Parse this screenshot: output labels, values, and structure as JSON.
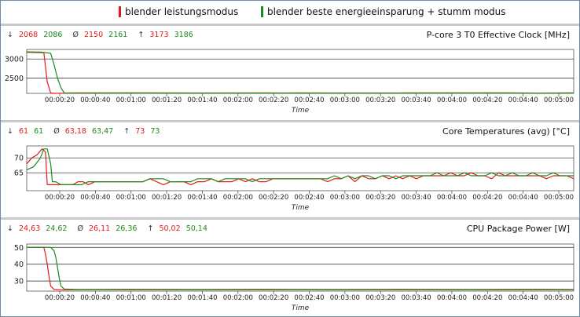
{
  "legend": [
    {
      "label": "blender leistungsmodus",
      "color": "#e31a1c"
    },
    {
      "label": "blender beste energieeinsparung + stumm modus",
      "color": "#1d8a1d"
    }
  ],
  "panels": [
    {
      "stats": {
        "min_symbol": "↓",
        "min_a": "2068",
        "min_b": "2086",
        "avg_symbol": "Ø",
        "avg_a": "2150",
        "avg_b": "2161",
        "max_symbol": "↑",
        "max_a": "3173",
        "max_b": "3186"
      }
    },
    {
      "stats": {
        "min_symbol": "↓",
        "min_a": "61",
        "min_b": "61",
        "avg_symbol": "Ø",
        "avg_a": "63,18",
        "avg_b": "63,47",
        "max_symbol": "↑",
        "max_a": "73",
        "max_b": "73"
      }
    },
    {
      "stats": {
        "min_symbol": "↓",
        "min_a": "24,63",
        "min_b": "24,62",
        "avg_symbol": "Ø",
        "avg_a": "26,11",
        "avg_b": "26,36",
        "max_symbol": "↑",
        "max_a": "50,02",
        "max_b": "50,14"
      }
    }
  ],
  "chart_data": [
    {
      "type": "line",
      "title": "P-core 3 T0 Effective Clock [MHz]",
      "xlabel": "Time",
      "ylabel": "",
      "ylim": [
        2100,
        3250
      ],
      "yticks": [
        2500,
        3000
      ],
      "xlim": [
        0,
        320
      ],
      "xticks": [
        "00:00:20",
        "00:00:40",
        "00:01:00",
        "00:01:20",
        "00:01:40",
        "00:02:00",
        "00:02:20",
        "00:02:40",
        "00:03:00",
        "00:03:20",
        "00:03:40",
        "00:04:00",
        "00:04:20",
        "00:04:40",
        "00:05:00"
      ],
      "grid": true,
      "series": [
        {
          "name": "blender leistungsmodus",
          "color": "#e31a1c",
          "x": [
            0,
            5,
            10,
            12,
            14,
            16,
            18,
            30,
            60,
            100,
            140,
            160,
            180,
            200,
            220,
            250,
            280,
            300,
            320
          ],
          "y": [
            3173,
            3170,
            3165,
            2400,
            2110,
            2100,
            2105,
            2105,
            2110,
            2108,
            2112,
            2105,
            2108,
            2110,
            2108,
            2112,
            2110,
            2106,
            2110
          ]
        },
        {
          "name": "blender beste energieeinsparung + stumm modus",
          "color": "#1d8a1d",
          "x": [
            0,
            8,
            14,
            16,
            18,
            20,
            22,
            30,
            60,
            100,
            140,
            160,
            180,
            200,
            220,
            250,
            280,
            300,
            320
          ],
          "y": [
            3186,
            3180,
            3150,
            2850,
            2500,
            2250,
            2110,
            2115,
            2112,
            2110,
            2108,
            2112,
            2110,
            2108,
            2112,
            2110,
            2115,
            2108,
            2112
          ]
        }
      ]
    },
    {
      "type": "line",
      "title": "Core Temperatures (avg) [°C]",
      "xlabel": "Time",
      "ylabel": "",
      "ylim": [
        59,
        74
      ],
      "yticks": [
        65,
        70
      ],
      "xlim": [
        0,
        320
      ],
      "xticks": [
        "00:00:20",
        "00:00:40",
        "00:01:00",
        "00:01:20",
        "00:01:40",
        "00:02:00",
        "00:02:20",
        "00:02:40",
        "00:03:00",
        "00:03:20",
        "00:03:40",
        "00:04:00",
        "00:04:20",
        "00:04:40",
        "00:05:00"
      ],
      "grid": true,
      "series": [
        {
          "name": "blender leistungsmodus",
          "color": "#e31a1c",
          "x": [
            0,
            3,
            6,
            9,
            11,
            12,
            13,
            15,
            18,
            20,
            22,
            24,
            27,
            30,
            33,
            36,
            40,
            44,
            48,
            52,
            56,
            60,
            64,
            68,
            72,
            76,
            80,
            84,
            88,
            92,
            96,
            100,
            104,
            108,
            112,
            116,
            120,
            124,
            128,
            132,
            136,
            140,
            144,
            148,
            152,
            156,
            160,
            164,
            168,
            172,
            176,
            180,
            184,
            188,
            192,
            196,
            200,
            204,
            208,
            212,
            216,
            220,
            224,
            228,
            232,
            236,
            240,
            244,
            248,
            252,
            256,
            260,
            264,
            268,
            272,
            276,
            280,
            284,
            288,
            292,
            296,
            300,
            304,
            308,
            312,
            316,
            320
          ],
          "y": [
            68,
            70,
            71,
            73,
            72,
            61,
            61,
            61,
            61,
            61,
            61,
            61,
            61,
            62,
            62,
            61,
            62,
            62,
            62,
            62,
            62,
            62,
            62,
            62,
            63,
            62,
            61,
            62,
            62,
            62,
            61,
            62,
            62,
            63,
            62,
            62,
            62,
            63,
            62,
            63,
            62,
            62,
            63,
            63,
            63,
            63,
            63,
            63,
            63,
            63,
            62,
            63,
            63,
            64,
            62,
            64,
            63,
            63,
            64,
            63,
            64,
            63,
            64,
            63,
            64,
            64,
            64,
            64,
            65,
            64,
            64,
            65,
            64,
            64,
            63,
            65,
            64,
            64,
            64,
            64,
            64,
            64,
            63,
            64,
            64,
            64,
            63
          ]
        },
        {
          "name": "blender beste energieeinsparung + stumm modus",
          "color": "#1d8a1d",
          "x": [
            0,
            4,
            8,
            10,
            12,
            14,
            15,
            17,
            20,
            24,
            28,
            32,
            36,
            40,
            44,
            48,
            52,
            56,
            60,
            64,
            68,
            72,
            76,
            80,
            84,
            88,
            92,
            96,
            100,
            104,
            108,
            112,
            116,
            120,
            124,
            128,
            132,
            136,
            140,
            144,
            148,
            152,
            156,
            160,
            164,
            168,
            172,
            176,
            180,
            184,
            188,
            192,
            196,
            200,
            204,
            208,
            212,
            216,
            220,
            224,
            228,
            232,
            236,
            240,
            244,
            248,
            252,
            256,
            260,
            264,
            268,
            272,
            276,
            280,
            284,
            288,
            292,
            296,
            300,
            304,
            308,
            312,
            316,
            320
          ],
          "y": [
            66,
            67,
            70,
            73,
            73,
            68,
            62,
            62,
            61,
            61,
            61,
            61,
            62,
            62,
            62,
            62,
            62,
            62,
            62,
            62,
            62,
            63,
            63,
            63,
            62,
            62,
            62,
            62,
            63,
            63,
            63,
            62,
            63,
            63,
            63,
            63,
            62,
            63,
            63,
            63,
            63,
            63,
            63,
            63,
            63,
            63,
            63,
            63,
            64,
            63,
            64,
            63,
            64,
            64,
            63,
            64,
            64,
            63,
            64,
            64,
            64,
            64,
            64,
            65,
            64,
            64,
            64,
            65,
            64,
            64,
            64,
            65,
            64,
            64,
            65,
            64,
            64,
            65,
            64,
            64,
            65,
            64,
            64,
            64
          ]
        }
      ]
    },
    {
      "type": "line",
      "title": "CPU Package Power [W]",
      "xlabel": "Time",
      "ylabel": "",
      "ylim": [
        24,
        52
      ],
      "yticks": [
        30,
        40,
        50
      ],
      "xlim": [
        0,
        320
      ],
      "xticks": [
        "00:00:20",
        "00:00:40",
        "00:01:00",
        "00:01:20",
        "00:01:40",
        "00:02:00",
        "00:02:20",
        "00:02:40",
        "00:03:00",
        "00:03:20",
        "00:03:40",
        "00:04:00",
        "00:04:20",
        "00:04:40",
        "00:05:00"
      ],
      "grid": true,
      "series": [
        {
          "name": "blender leistungsmodus",
          "color": "#e31a1c",
          "x": [
            0,
            5,
            10,
            11,
            12,
            13,
            14,
            16,
            20,
            60,
            100,
            140,
            180,
            220,
            260,
            300,
            320
          ],
          "y": [
            50.0,
            50.0,
            50.0,
            46,
            40,
            33,
            27,
            25,
            24.8,
            24.9,
            24.8,
            24.9,
            24.8,
            24.9,
            24.8,
            24.9,
            24.8
          ]
        },
        {
          "name": "blender beste energieeinsparung + stumm modus",
          "color": "#1d8a1d",
          "x": [
            0,
            5,
            10,
            14,
            16,
            17,
            18,
            19,
            20,
            22,
            30,
            60,
            100,
            140,
            180,
            220,
            260,
            300,
            320
          ],
          "y": [
            50.1,
            50.1,
            50.1,
            50.0,
            48,
            44,
            38,
            32,
            27,
            25.2,
            25.0,
            25.1,
            25.0,
            25.1,
            25.0,
            25.1,
            25.0,
            25.1,
            25.0
          ]
        }
      ]
    }
  ]
}
